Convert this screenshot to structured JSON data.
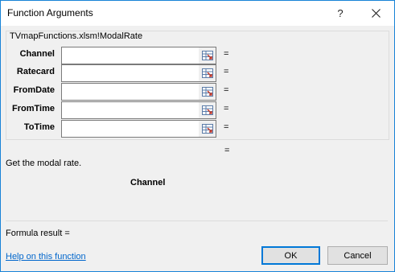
{
  "dialog": {
    "title": "Function Arguments",
    "help_glyph": "?",
    "close_icon": "close-icon"
  },
  "group": {
    "title": "TVmapFunctions.xlsm!ModalRate"
  },
  "arguments": [
    {
      "label": "Channel",
      "value": "",
      "result": "="
    },
    {
      "label": "Ratecard",
      "value": "",
      "result": "="
    },
    {
      "label": "FromDate",
      "value": "",
      "result": "="
    },
    {
      "label": "FromTime",
      "value": "",
      "result": "="
    },
    {
      "label": "ToTime",
      "value": "",
      "result": "="
    }
  ],
  "result_eq": "=",
  "description": "Get the modal rate.",
  "current_arg": "Channel",
  "formula_result": "Formula result =",
  "help_link": "Help on this function",
  "buttons": {
    "ok": "OK",
    "cancel": "Cancel"
  },
  "colors": {
    "accent": "#0078d7",
    "link": "#0066cc",
    "background": "#f0f0f0"
  }
}
